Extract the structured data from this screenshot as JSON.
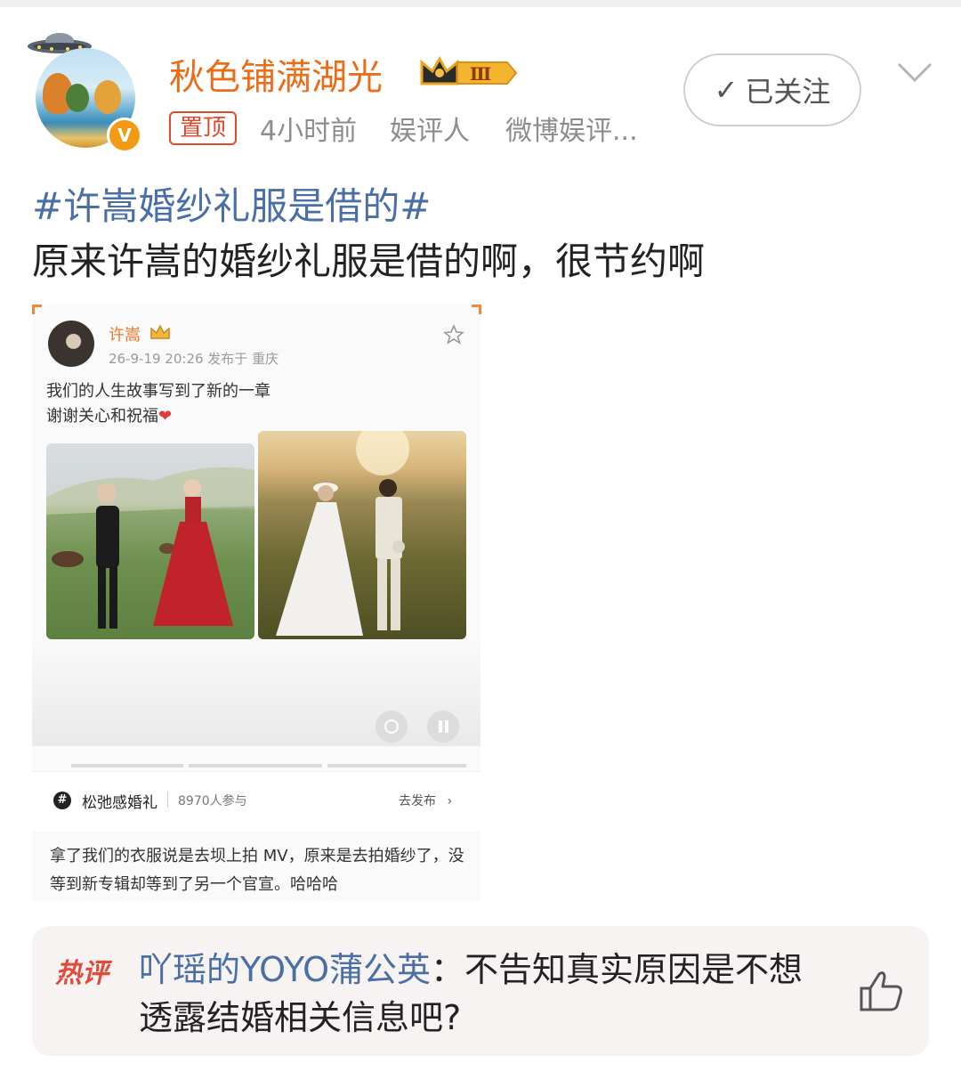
{
  "post": {
    "username": "秋色铺满湖光",
    "level_badge": "Ⅲ",
    "verified_mark": "V",
    "pinned_label": "置顶",
    "time": "4小时前",
    "role": "娱评人",
    "source": "微博娱评...",
    "follow_label": "已关注",
    "topic": "#许嵩婚纱礼服是借的#",
    "text": "原来许嵩的婚纱礼服是借的啊，很节约啊",
    "icons": [
      "ufo-icon",
      "crown-level-icon",
      "check-icon",
      "chevron-down-icon"
    ]
  },
  "embedded": {
    "author": "许嵩",
    "date": "26-9-19 20:26  发布于 重庆",
    "line1": "我们的人生故事写到了新的一章",
    "line2": "谢谢关心和祝福",
    "heart": "❤",
    "topic_name": "松弛感婚礼",
    "participants": "8970人参与",
    "go_post": "去发布",
    "go_arrow": "›",
    "hash_symbol": "#",
    "comment_text": "拿了我们的衣服说是去坝上拍 MV，原来是去拍婚纱了，没等到新专辑却等到了另一个官宣。哈哈哈",
    "icons": [
      "star-icon",
      "camera-icon",
      "pause-icon",
      "hash-icon"
    ]
  },
  "hot_comment": {
    "badge": "热评",
    "user": "吖瑶的YOYO蒲公英",
    "separator": "：",
    "text": "不告知真实原因是不想透露结婚相关信息吧?",
    "icons": [
      "thumbs-up-icon"
    ]
  },
  "colors": {
    "username": "#ea6d1a",
    "topic": "#4a6fa6",
    "pin": "#e2492b",
    "hot_badge": "#e24a3b"
  }
}
